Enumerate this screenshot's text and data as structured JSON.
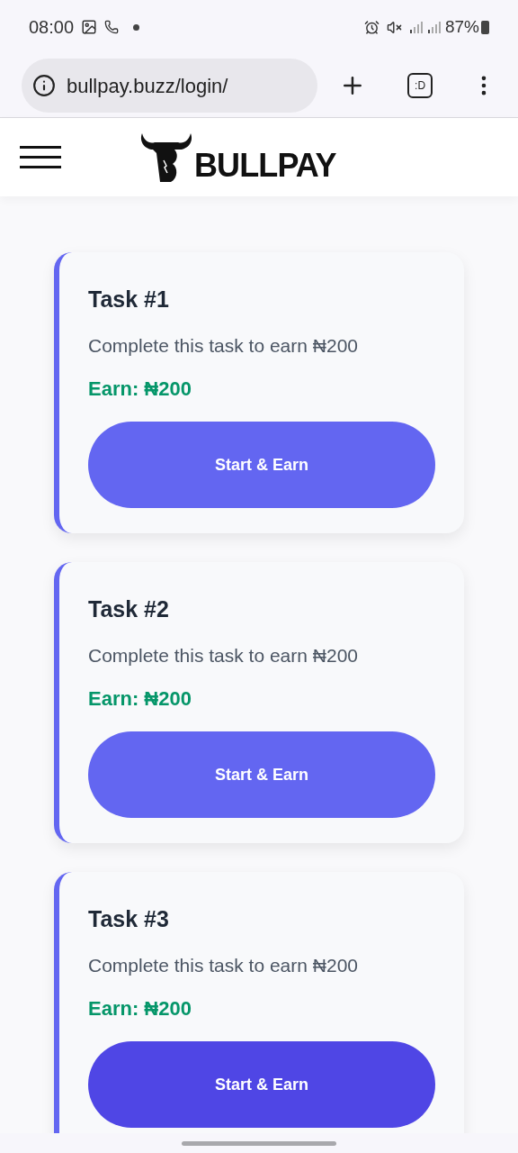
{
  "status_bar": {
    "time": "08:00",
    "battery": "87%"
  },
  "browser": {
    "url": "bullpay.buzz/login/",
    "tab_label": ":D"
  },
  "header": {
    "logo_text": "BULLPAY"
  },
  "tasks": [
    {
      "title": "Task #1",
      "description": "Complete this task to earn ₦200",
      "earn": "Earn: ₦200",
      "button": "Start & Earn",
      "pressed": false
    },
    {
      "title": "Task #2",
      "description": "Complete this task to earn ₦200",
      "earn": "Earn: ₦200",
      "button": "Start & Earn",
      "pressed": false
    },
    {
      "title": "Task #3",
      "description": "Complete this task to earn ₦200",
      "earn": "Earn: ₦200",
      "button": "Start & Earn",
      "pressed": true
    }
  ]
}
